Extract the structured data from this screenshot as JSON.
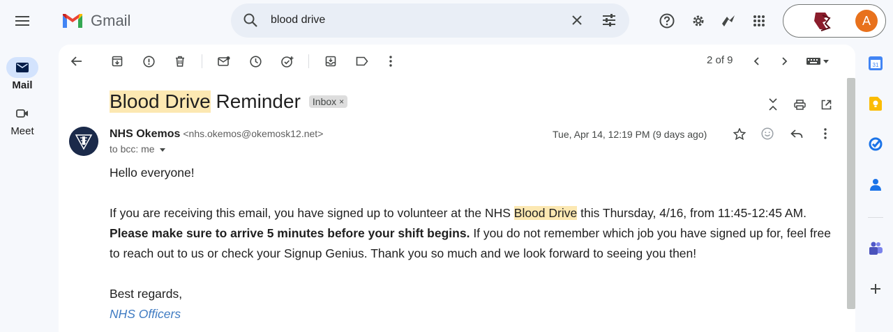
{
  "app": {
    "name": "Gmail"
  },
  "search": {
    "value": "blood drive"
  },
  "rail": {
    "mail_label": "Mail",
    "meet_label": "Meet"
  },
  "account": {
    "avatar_letter": "A",
    "avatar_color": "#e8711c"
  },
  "toolbar": {
    "pager": "2 of 9"
  },
  "email": {
    "subject_highlight": "Blood Drive",
    "subject_rest": " Reminder",
    "label": "Inbox",
    "label_close": "×",
    "sender_name": "NHS Okemos",
    "sender_email": "<nhs.okemos@okemosk12.net>",
    "to": "to bcc: me",
    "date": "Tue, Apr 14, 12:19 PM (9 days ago)",
    "greeting": "Hello everyone!",
    "p1_a": "If you are receiving this email, you have signed up to volunteer at the NHS ",
    "p1_hl": "Blood Drive",
    "p1_b": " this Thursday, 4/16, from 11:45-12:45 AM. ",
    "p1_bold": "Please make sure to arrive 5 minutes before your shift begins.",
    "p1_c": " If you do not remember which job you have signed up for, feel free to reach out to us or check your Signup Genius. Thank you so much and we look forward to seeing you then!",
    "closing": "Best regards,",
    "signature": "NHS Officers"
  },
  "colors": {
    "highlight": "#fce8b2",
    "signature": "#3f7bc2",
    "search_bg": "#e9eef6",
    "rail_active": "#d3e3fd"
  }
}
